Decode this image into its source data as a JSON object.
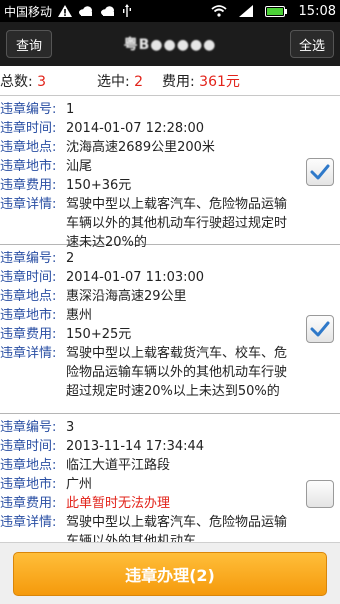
{
  "status_bar": {
    "carrier": "中国移动",
    "time": "15:08",
    "icons": [
      "warning-icon",
      "cloud-icon",
      "cloud-icon",
      "usb-icon",
      "wifi-icon",
      "signal-icon",
      "battery-icon"
    ]
  },
  "header": {
    "back_label": "查询",
    "plate": "粤B●●●●●",
    "select_all_label": "全选"
  },
  "summary": {
    "total_label": "总数:",
    "total_value": "3",
    "selected_label": "选中:",
    "selected_value": "2",
    "fee_label": "费用:",
    "fee_value": "361元"
  },
  "field_labels": {
    "number": "违章编号:",
    "time": "违章时间:",
    "location": "违章地点:",
    "city": "违章地市:",
    "fee": "违章费用:",
    "detail": "违章详情:"
  },
  "records": [
    {
      "number": "1",
      "time": "2014-01-07 12:28:00",
      "location": "沈海高速2689公里200米",
      "city": "汕尾",
      "fee": "150+36元",
      "fee_unavailable": false,
      "detail": "驾驶中型以上载客汽车、危险物品运输车辆以外的其他机动车行驶超过规定时速未达20%的",
      "checked": true
    },
    {
      "number": "2",
      "time": "2014-01-07 11:03:00",
      "location": "惠深沿海高速29公里",
      "city": "惠州",
      "fee": "150+25元",
      "fee_unavailable": false,
      "detail": "驾驶中型以上载客载货汽车、校车、危险物品运输车辆以外的其他机动车行驶超过规定时速20%以上未达到50%的",
      "checked": true
    },
    {
      "number": "3",
      "time": "2013-11-14 17:34:44",
      "location": "临江大道平江路段",
      "city": "广州",
      "fee": "此单暂时无法办理",
      "fee_unavailable": true,
      "detail": "驾驶中型以上载客汽车、危险物品运输车辆以外的其他机动车",
      "checked": false
    }
  ],
  "footer": {
    "submit_label": "违章办理(2)"
  },
  "colors": {
    "accent_orange": "#f5a623",
    "label_blue": "#2a4fa3",
    "value_red": "#e2231a",
    "check_blue": "#2f79c9"
  }
}
